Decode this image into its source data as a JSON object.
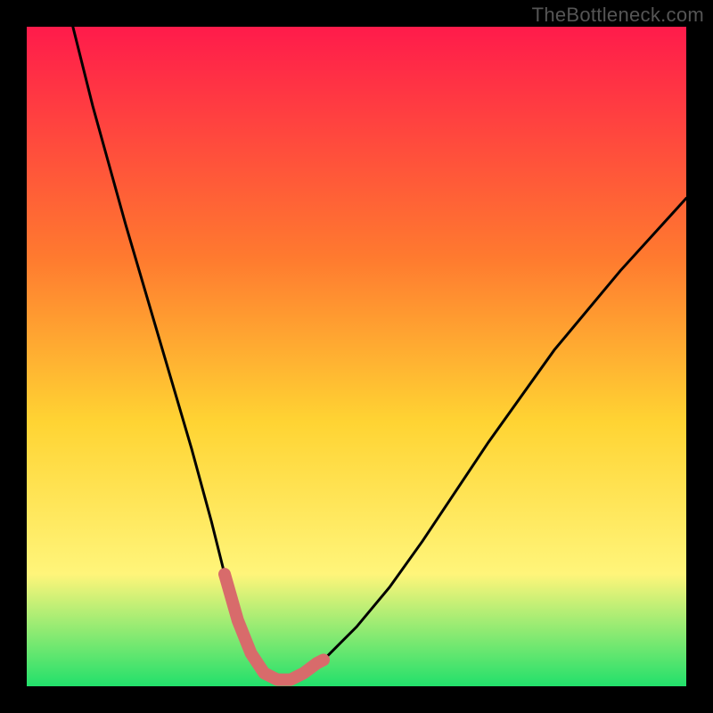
{
  "watermark": "TheBottleneck.com",
  "colors": {
    "frame": "#000000",
    "gradient_top": "#ff1b4b",
    "gradient_mid1": "#ff7a2f",
    "gradient_mid2": "#ffd433",
    "gradient_mid3": "#fff57a",
    "gradient_bottom": "#22e06b",
    "curve": "#000000",
    "highlight": "#d86b6b"
  },
  "chart_data": {
    "type": "line",
    "title": "",
    "xlabel": "",
    "ylabel": "",
    "xlim": [
      0,
      100
    ],
    "ylim": [
      0,
      100
    ],
    "series": [
      {
        "name": "bottleneck-curve",
        "x": [
          7,
          10,
          15,
          20,
          25,
          28,
          30,
          32,
          34,
          36,
          38,
          40,
          42,
          45,
          50,
          55,
          60,
          70,
          80,
          90,
          100
        ],
        "y": [
          100,
          88,
          70,
          53,
          36,
          25,
          17,
          10,
          5,
          2,
          1,
          1,
          2,
          4,
          9,
          15,
          22,
          37,
          51,
          63,
          74
        ]
      }
    ],
    "highlight": {
      "name": "valley-segment",
      "x": [
        30,
        32,
        34,
        36,
        38,
        40,
        42,
        44,
        45
      ],
      "y": [
        17,
        10,
        5,
        2,
        1,
        1,
        2,
        3.5,
        4
      ]
    },
    "annotations": []
  }
}
